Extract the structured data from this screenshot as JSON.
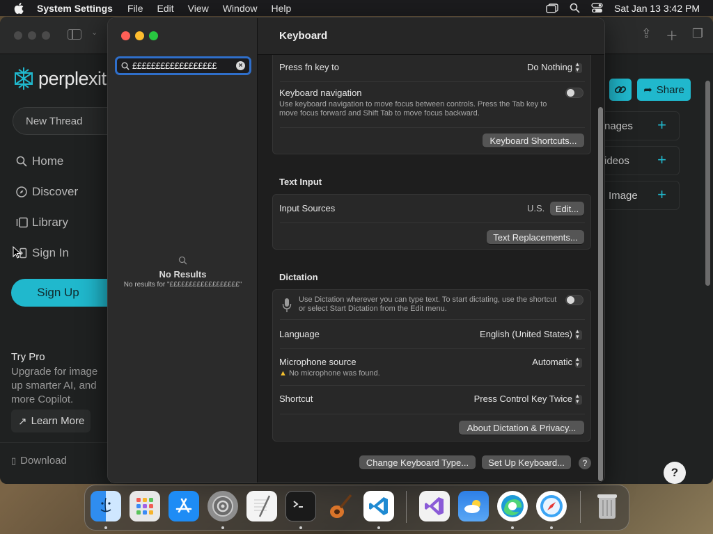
{
  "menubar": {
    "app_name": "System Settings",
    "menus": [
      "File",
      "Edit",
      "View",
      "Window",
      "Help"
    ],
    "clock": "Sat Jan 13  3:42 PM"
  },
  "browser": {
    "logo_text": "perplexit",
    "new_thread": "New Thread",
    "nav": [
      "Home",
      "Discover",
      "Library",
      "Sign In"
    ],
    "sign_up": "Sign Up",
    "try_pro_title": "Try Pro",
    "try_pro_body": "Upgrade for image up smarter AI, and more Copilot.",
    "learn_more": "Learn More",
    "download": "Download",
    "share": "Share",
    "panel_rows": [
      "nages",
      "ideos",
      "Image"
    ],
    "help": "?"
  },
  "settings": {
    "search_value": "££££££££££££££££££",
    "no_results_title": "No Results",
    "no_results_sub": "No results for \"££££££££££££££££££\"",
    "header_title": "Keyboard",
    "press_fn_label": "Press fn key to",
    "press_fn_value": "Do Nothing",
    "keyboard_nav_label": "Keyboard navigation",
    "keyboard_nav_desc": "Use keyboard navigation to move focus between controls. Press the Tab key to move focus forward and Shift Tab to move focus backward.",
    "keyboard_shortcuts_btn": "Keyboard Shortcuts...",
    "text_input_title": "Text Input",
    "input_sources_label": "Input Sources",
    "input_sources_value": "U.S.",
    "edit_btn": "Edit...",
    "text_replacements_btn": "Text Replacements...",
    "dictation_title": "Dictation",
    "dictation_desc": "Use Dictation wherever you can type text. To start dictating, use the shortcut or select Start Dictation from the Edit menu.",
    "language_label": "Language",
    "language_value": "English (United States)",
    "mic_label": "Microphone source",
    "mic_value": "Automatic",
    "mic_warning": "No microphone was found.",
    "shortcut_label": "Shortcut",
    "shortcut_value": "Press Control Key Twice",
    "about_dictation_btn": "About Dictation & Privacy...",
    "change_kb_type_btn": "Change Keyboard Type...",
    "set_up_kb_btn": "Set Up Keyboard...",
    "help": "?"
  },
  "dock": {
    "apps": [
      "finder-icon",
      "launchpad-icon",
      "app-store-icon",
      "system-settings-icon",
      "textedit-icon",
      "terminal-icon",
      "garageband-icon",
      "vscode-icon",
      "visual-studio-icon",
      "weather-icon",
      "edge-icon",
      "safari-icon",
      "trash-icon"
    ]
  },
  "colors": {
    "accent_teal": "#20b8cd",
    "focus_blue": "#2f6fcb"
  }
}
